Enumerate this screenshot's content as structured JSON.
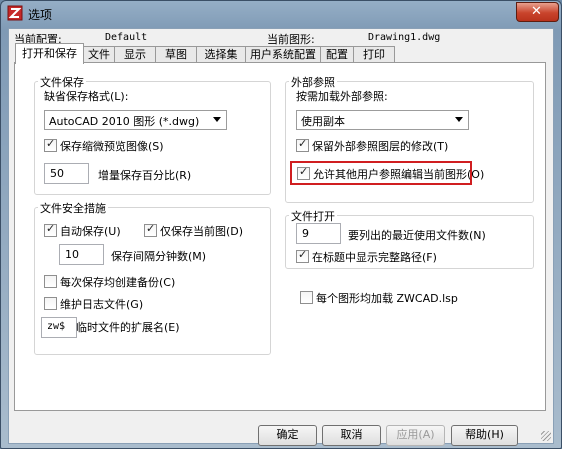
{
  "window": {
    "title": "选项",
    "close_label": "✕"
  },
  "profile": {
    "label": "当前配置:",
    "value": "Default"
  },
  "drawing": {
    "label": "当前图形:",
    "value": "Drawing1.dwg"
  },
  "tabs": [
    "打开和保存",
    "文件",
    "显示",
    "草图",
    "选择集",
    "用户系统配置",
    "配置",
    "打印"
  ],
  "file_save": {
    "title": "文件保存",
    "format_label": "缺省保存格式(L):",
    "format_value": "AutoCAD 2010 图形 (*.dwg)",
    "thumbnail_label": "保存缩微预览图像(S)",
    "thumbnail_checked": true,
    "increment_value": "50",
    "increment_label": "增量保存百分比(R)"
  },
  "file_safety": {
    "title": "文件安全措施",
    "autosave_label": "自动保存(U)",
    "autosave_checked": true,
    "current_only_label": "仅保存当前图(D)",
    "current_only_checked": true,
    "interval_value": "10",
    "interval_label": "保存间隔分钟数(M)",
    "backup_label": "每次保存均创建备份(C)",
    "backup_checked": false,
    "log_label": "维护日志文件(G)",
    "log_checked": false,
    "ext_value": "zw$",
    "ext_label": "临时文件的扩展名(E)"
  },
  "xref": {
    "title": "外部参照",
    "demand_label": "按需加载外部参照:",
    "demand_value": "使用副本",
    "retain_label": "保留外部参照图层的修改(T)",
    "retain_checked": true,
    "allow_label": "允许其他用户参照编辑当前图形(O)",
    "allow_checked": true
  },
  "file_open": {
    "title": "文件打开",
    "recent_value": "9",
    "recent_label": "要列出的最近使用文件数(N)",
    "fullpath_label": "在标题中显示完整路径(F)",
    "fullpath_checked": true
  },
  "lsp": {
    "label": "每个图形均加载 ZWCAD.lsp",
    "checked": false
  },
  "buttons": {
    "ok": "确定",
    "cancel": "取消",
    "apply": "应用(A)",
    "help": "帮助(H)"
  }
}
